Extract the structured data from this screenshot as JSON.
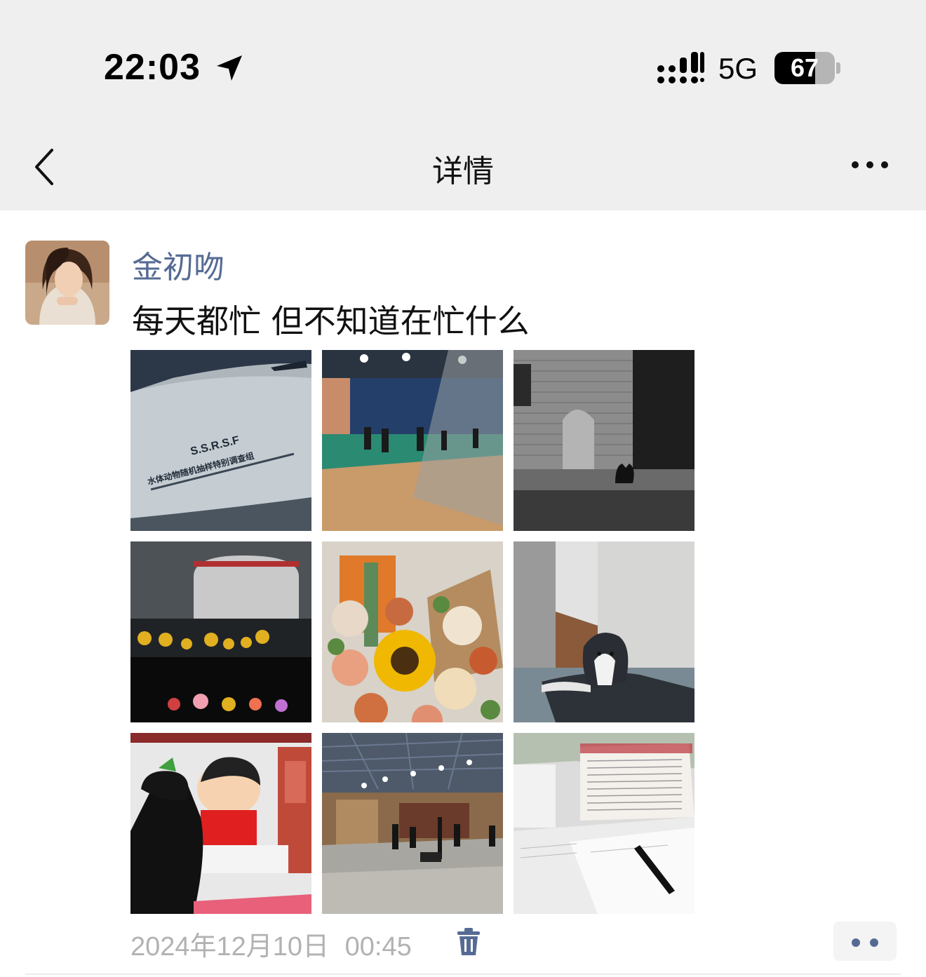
{
  "status_bar": {
    "time": "22:03",
    "network": "5G",
    "battery_text": "67",
    "battery_level": 0.67,
    "icons": [
      "location-arrow-icon",
      "signal-icon",
      "battery-icon"
    ]
  },
  "nav": {
    "title": "详情",
    "back_icon": "chevron-left-icon",
    "more_icon": "more-dots-icon"
  },
  "post": {
    "author": "金初吻",
    "text": "每天都忙 但不知道在忙什么",
    "date": "2024年12月10日",
    "time": "00:45",
    "photos": [
      {
        "name": "photo-van-ssrsf",
        "caption_lines": [
          "S.S.R.S.F",
          "水体动物随机抽样特别调查组"
        ]
      },
      {
        "name": "photo-volleyball-court"
      },
      {
        "name": "photo-cat-wall"
      },
      {
        "name": "photo-ducks-dashboard"
      },
      {
        "name": "photo-sunflower-bouquet"
      },
      {
        "name": "photo-border-collie"
      },
      {
        "name": "photo-crayon-shinchan"
      },
      {
        "name": "photo-gym-hall"
      },
      {
        "name": "photo-letter-pen"
      }
    ],
    "delete_icon": "trash-icon",
    "action_icon": "more-dots-icon"
  },
  "colors": {
    "topbar_bg": "#efefef",
    "name_color": "#566b94",
    "meta_color": "#b2b2b2"
  }
}
